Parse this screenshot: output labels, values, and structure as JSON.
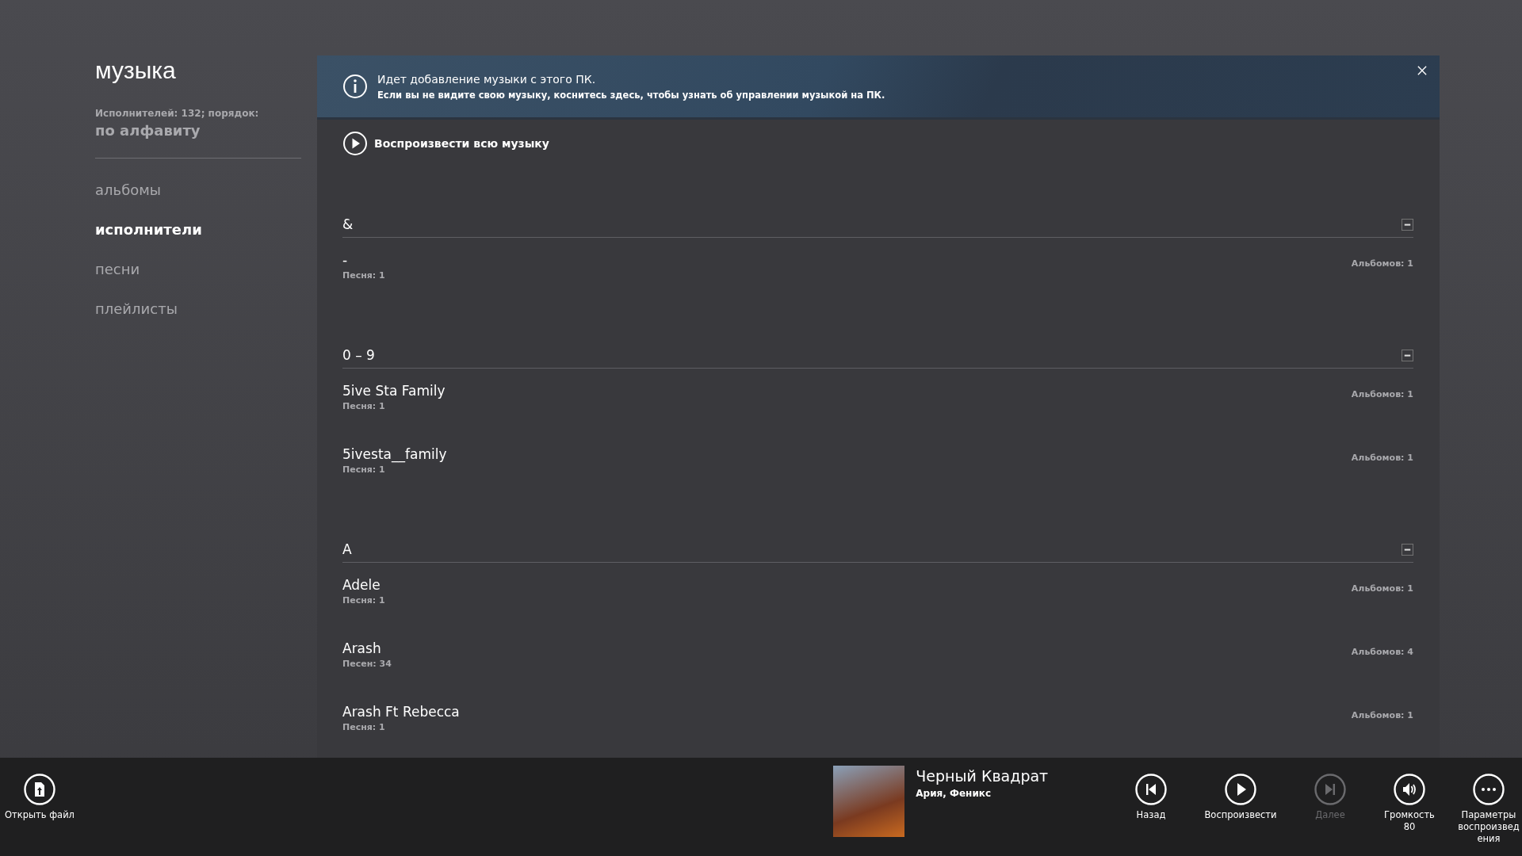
{
  "sidebar": {
    "title": "музыка",
    "summary": "Исполнителей: 132; порядок:",
    "sort": "по алфавиту",
    "items": [
      {
        "label": "альбомы",
        "selected": false
      },
      {
        "label": "исполнители",
        "selected": true
      },
      {
        "label": "песни",
        "selected": false
      },
      {
        "label": "плейлисты",
        "selected": false
      }
    ]
  },
  "banner": {
    "title": "Идет добавление музыки с этого ПК.",
    "text": "Если вы не видите свою музыку, коснитесь здесь, чтобы узнать об управлении музыкой на ПК."
  },
  "play_all": "Воспроизвести всю музыку",
  "sections": [
    {
      "header": "&",
      "expanded": true,
      "rows": [
        {
          "name": "-",
          "songs": "Песня: 1",
          "albums": "Альбомов: 1"
        }
      ]
    },
    {
      "header": "0 – 9",
      "expanded": true,
      "rows": [
        {
          "name": "5ive Sta Family",
          "songs": "Песня: 1",
          "albums": "Альбомов: 1"
        },
        {
          "name": "5ivesta__family",
          "songs": "Песня: 1",
          "albums": "Альбомов: 1"
        }
      ]
    },
    {
      "header": "A",
      "expanded": true,
      "rows": [
        {
          "name": "Adele",
          "songs": "Песня: 1",
          "albums": "Альбомов: 1"
        },
        {
          "name": "Arash",
          "songs": "Песен: 34",
          "albums": "Альбомов: 4"
        },
        {
          "name": "Arash Ft Rebecca",
          "songs": "Песня: 1",
          "albums": "Альбомов: 1"
        }
      ]
    }
  ],
  "app_bar": {
    "left": [
      {
        "kind": "open-file",
        "label": "Открыть файл",
        "disabled": false
      }
    ],
    "now_playing": {
      "title": "Черный Квадрат",
      "subtitle": "Ария, Феникс"
    },
    "right": [
      {
        "kind": "previous",
        "label": "Назад",
        "disabled": false
      },
      {
        "kind": "play",
        "label": "Воспроизвести",
        "disabled": false
      },
      {
        "kind": "next",
        "label": "Далее",
        "disabled": true
      },
      {
        "kind": "volume",
        "label": "Громкость 80",
        "disabled": false
      },
      {
        "kind": "more",
        "label": "Параметры воспроизведения",
        "disabled": false
      }
    ]
  }
}
